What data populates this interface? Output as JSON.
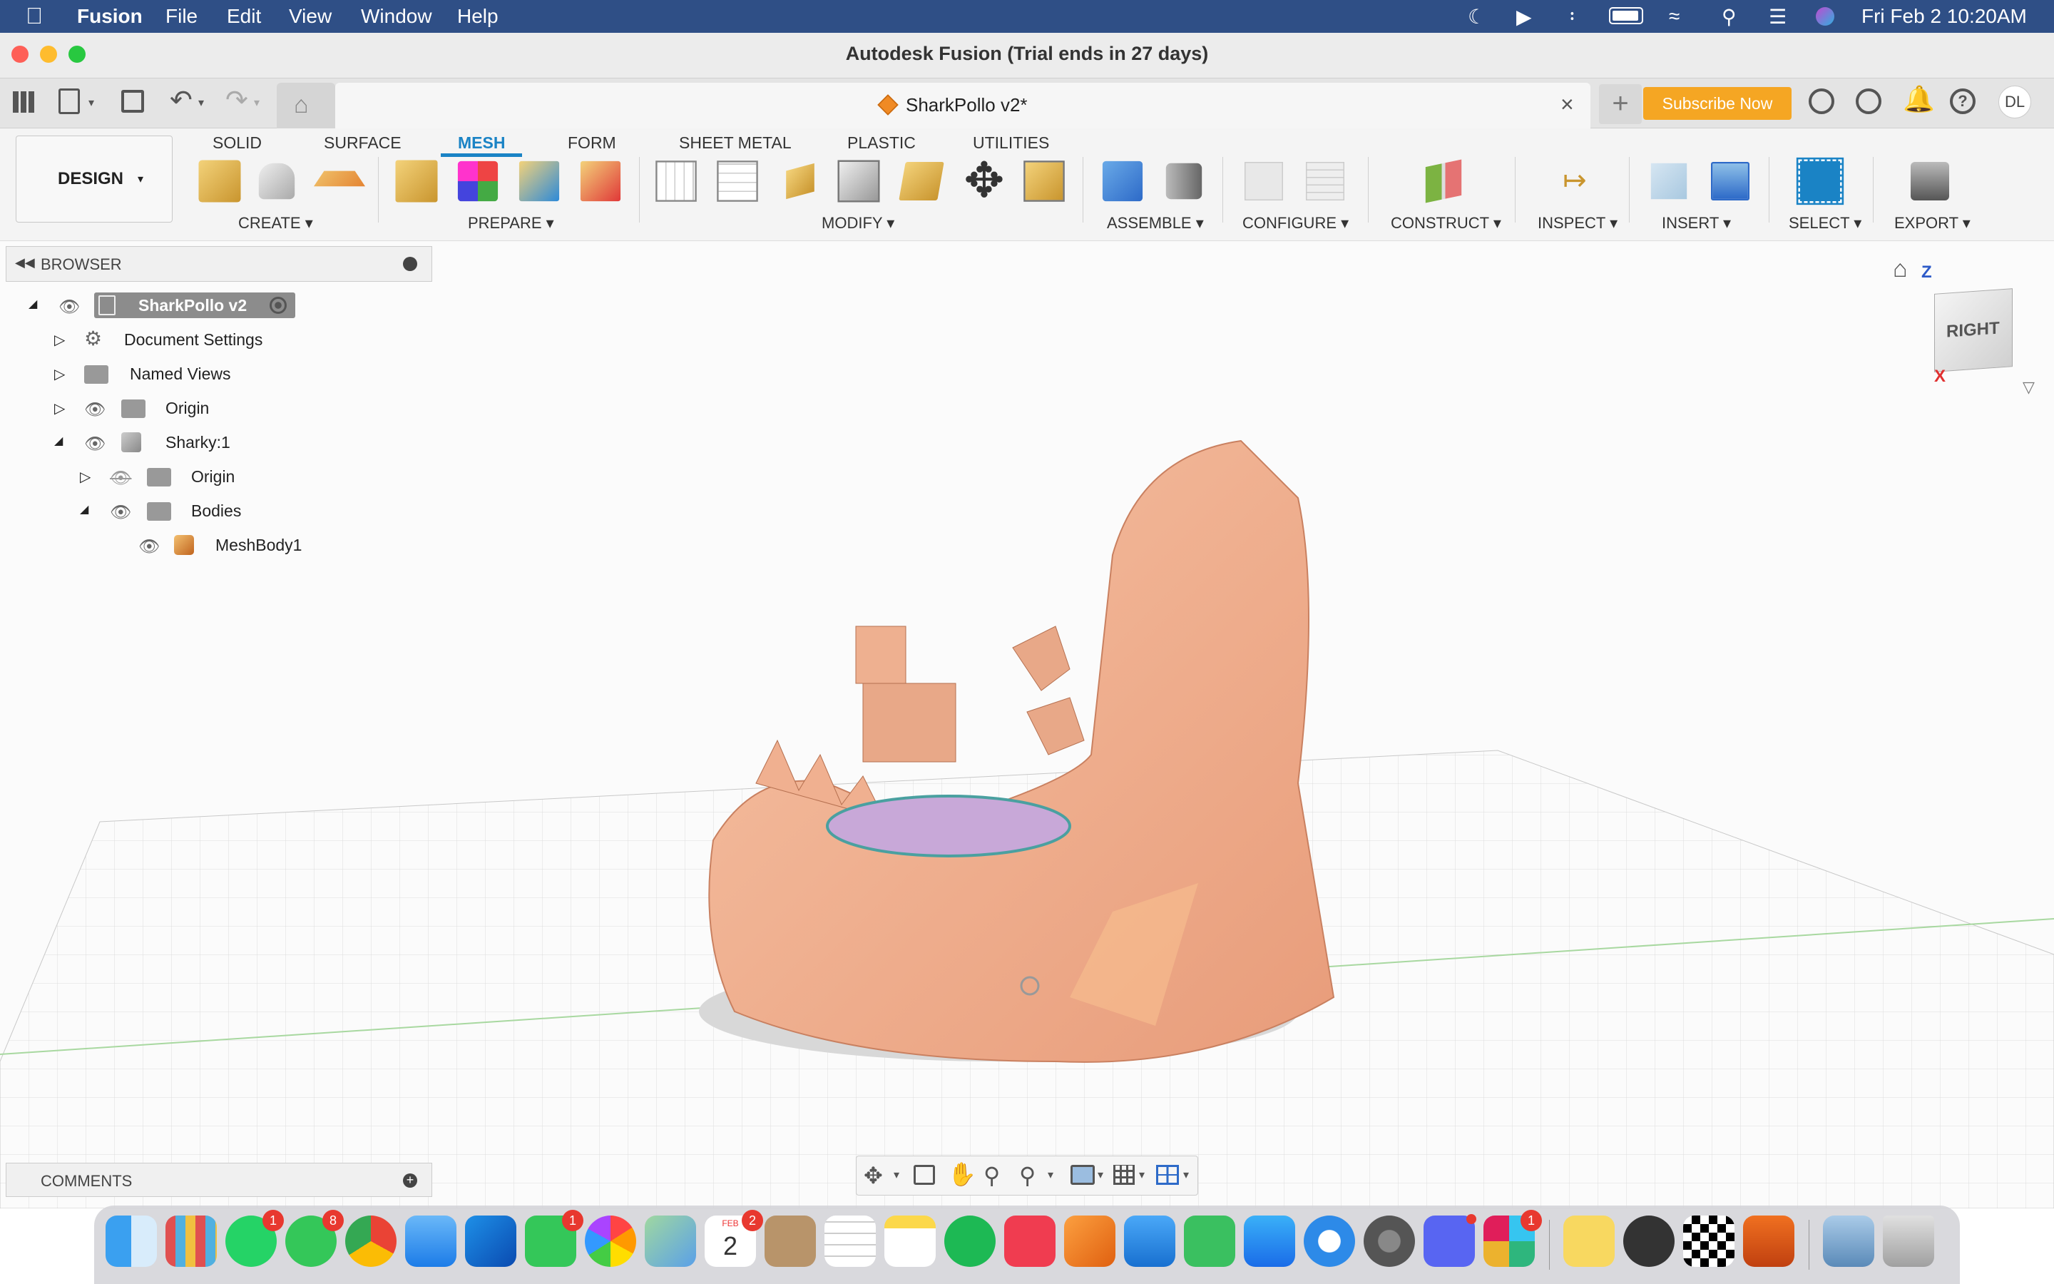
{
  "menubar": {
    "apple": "",
    "app_name": "Fusion",
    "items": [
      "File",
      "Edit",
      "View",
      "Window",
      "Help"
    ],
    "clock": "Fri Feb 2  10:20AM",
    "status_icons": [
      "moon-icon",
      "play-icon",
      "bluetooth-icon",
      "battery-icon",
      "wifi-icon",
      "search-icon",
      "control-center-icon",
      "siri-icon"
    ]
  },
  "window": {
    "title": "Autodesk Fusion (Trial ends in 27 days)",
    "doc_tab": "SharkPollo v2*",
    "subscribe": "Subscribe Now",
    "user_initials": "DL"
  },
  "ribbon": {
    "workspace": "DESIGN",
    "tabs": [
      "SOLID",
      "SURFACE",
      "MESH",
      "FORM",
      "SHEET METAL",
      "PLASTIC",
      "UTILITIES"
    ],
    "active_tab": "MESH",
    "groups": [
      "CREATE",
      "PREPARE",
      "MODIFY",
      "ASSEMBLE",
      "CONFIGURE",
      "CONSTRUCT",
      "INSPECT",
      "INSERT",
      "SELECT",
      "EXPORT"
    ]
  },
  "browser": {
    "title": "BROWSER",
    "root": "SharkPollo v2",
    "items": [
      {
        "label": "Document Settings",
        "icon": "gear-icon"
      },
      {
        "label": "Named Views",
        "icon": "folder-icon"
      },
      {
        "label": "Origin",
        "icon": "folder-icon"
      },
      {
        "label": "Sharky:1",
        "icon": "component-icon"
      },
      {
        "label": "Origin",
        "icon": "folder-icon"
      },
      {
        "label": "Bodies",
        "icon": "folder-icon"
      },
      {
        "label": "MeshBody1",
        "icon": "mesh-body-icon"
      }
    ]
  },
  "viewcube": {
    "face": "RIGHT",
    "axis_z": "Z",
    "axis_x": "X"
  },
  "comments": {
    "title": "COMMENTS"
  },
  "dock": {
    "badges": {
      "whatsapp": "1",
      "messages": "8",
      "facetime": "1",
      "calendar": "2",
      "slack": "1"
    },
    "calendar_month": "FEB",
    "calendar_day": "2"
  },
  "colors": {
    "menubar": "#2f4f86",
    "accent": "#1a83c5",
    "subscribe": "#f5a623",
    "mesh": "#f2b08f"
  }
}
